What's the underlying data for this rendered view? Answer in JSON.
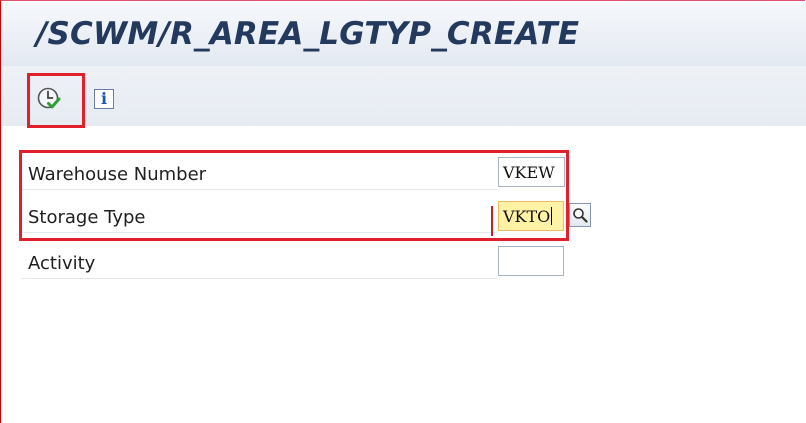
{
  "window": {
    "title": "/SCWM/R_AREA_LGTYP_CREATE"
  },
  "toolbar": {
    "execute_icon": "execute-clock-check-icon",
    "info_icon": "info-icon",
    "info_glyph": "i"
  },
  "form": {
    "warehouse_number": {
      "label": "Warehouse Number",
      "value": "VKEW"
    },
    "storage_type": {
      "label": "Storage Type",
      "value": "VKTO"
    },
    "activity": {
      "label": "Activity",
      "value": ""
    }
  },
  "colors": {
    "highlight": "#e0202a",
    "title": "#233a5e",
    "focused_field": "#fff2a6"
  }
}
